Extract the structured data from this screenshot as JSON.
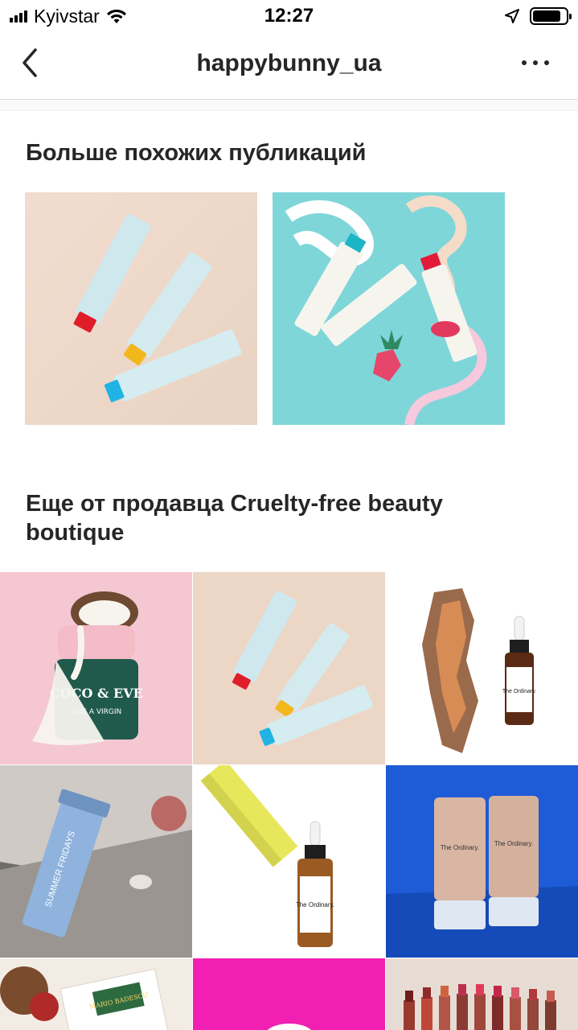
{
  "status_bar": {
    "carrier": "Kyivstar",
    "time": "12:27"
  },
  "nav": {
    "title": "happybunny_ua",
    "back_icon": "chevron-left-icon",
    "more_icon": "more-horizontal-icon"
  },
  "sections": {
    "similar": {
      "title": "Больше похожих публикаций"
    },
    "seller": {
      "title": "Еще от продавца Cruelty-free beauty boutique"
    }
  },
  "product_labels": {
    "coco_brand": "COCO & EVE",
    "coco_tagline": "LIKE A VIRGIN",
    "ordinary_brand": "The Ordinary.",
    "summer_brand": "SUMMER FRIDAYS",
    "mario_brand": "MARIO BADESCU"
  },
  "colors": {
    "text": "#262626",
    "separator": "#dbdbdb"
  }
}
